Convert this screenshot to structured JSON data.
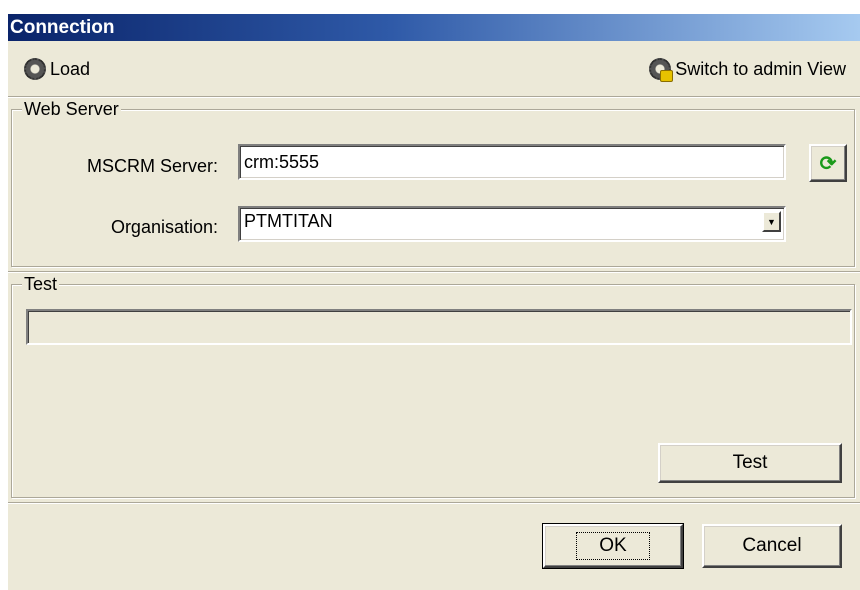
{
  "window": {
    "title": "Connection"
  },
  "toolbar": {
    "load_label": "Load",
    "admin_label": "Switch to admin View",
    "load_icon": "gear-icon",
    "admin_icon": "gear-lock-icon"
  },
  "web_server": {
    "legend": "Web Server",
    "server_label": "MSCRM Server:",
    "server_value": "crm:5555",
    "refresh_icon": "refresh-icon",
    "org_label": "Organisation:",
    "org_value": "PTMTITAN"
  },
  "test_group": {
    "legend": "Test",
    "progress_value": 0,
    "test_button": "Test"
  },
  "footer": {
    "ok_label": "OK",
    "cancel_label": "Cancel"
  },
  "colors": {
    "title_start": "#0a246a",
    "title_end": "#a6caf0",
    "window_bg": "#ece9d8",
    "refresh_green": "#1a9a1a"
  }
}
